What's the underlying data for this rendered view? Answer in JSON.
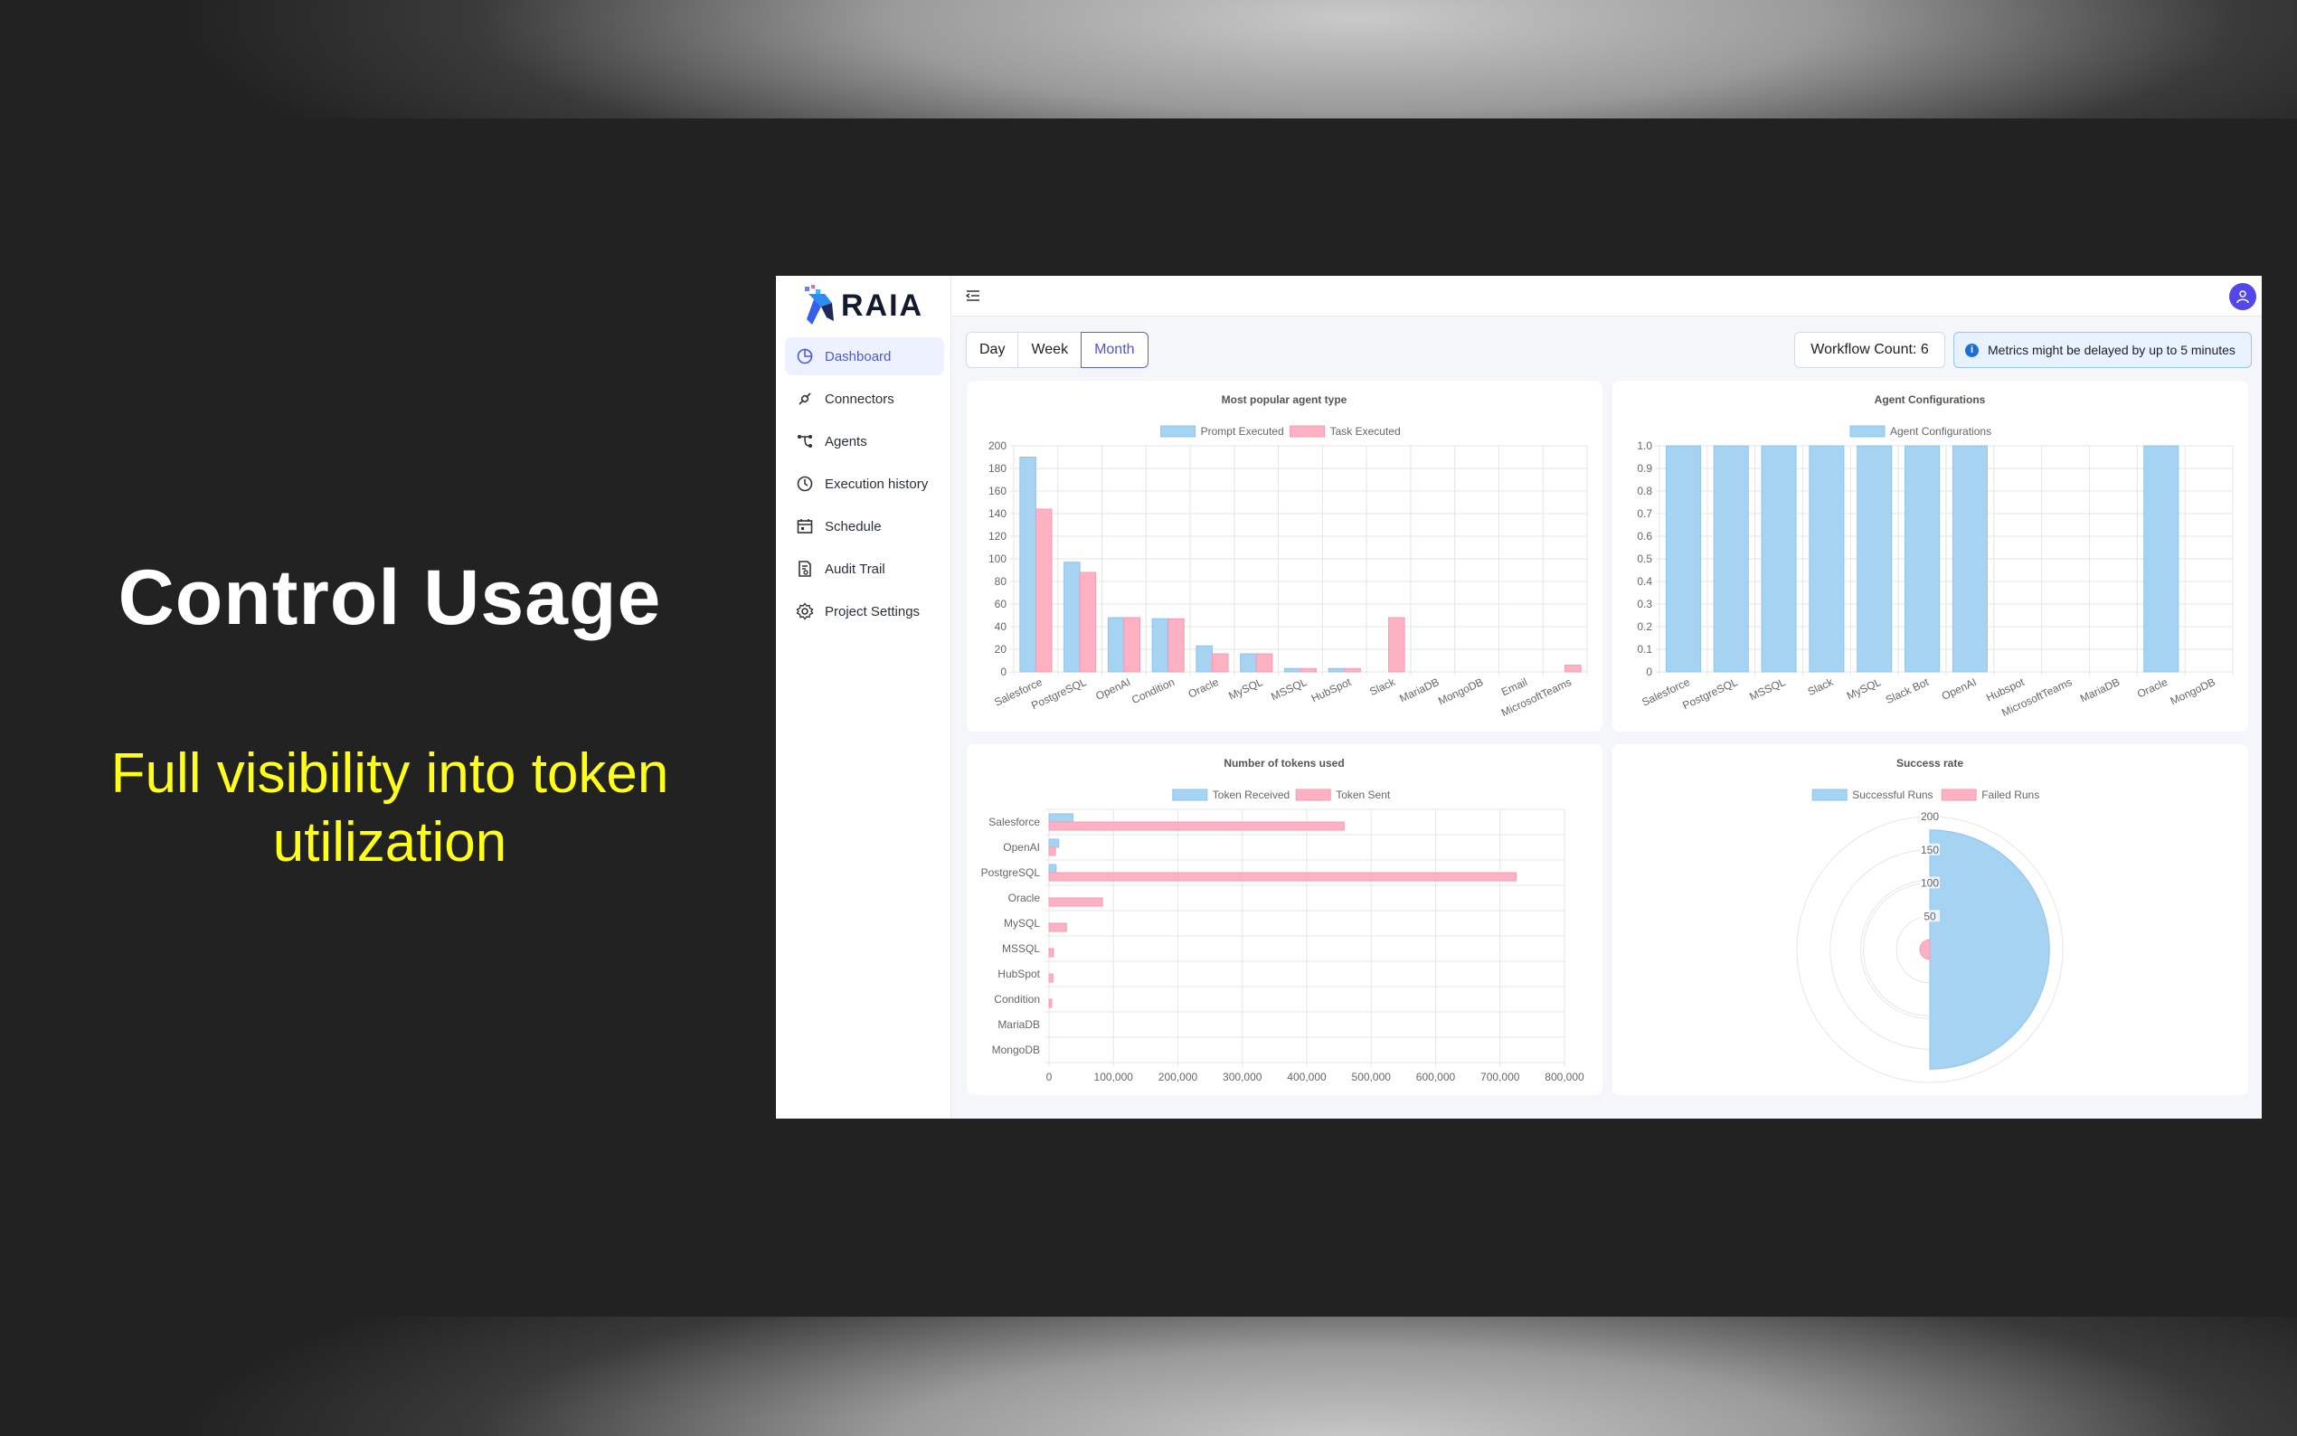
{
  "hero": {
    "title": "Control Usage",
    "subtitle": "Full visibility into token utilization"
  },
  "app": {
    "brand": "RAIA",
    "sidebar": {
      "items": [
        {
          "label": "Dashboard",
          "icon": "dashboard-icon",
          "active": true
        },
        {
          "label": "Connectors",
          "icon": "connectors-icon"
        },
        {
          "label": "Agents",
          "icon": "agents-icon"
        },
        {
          "label": "Execution history",
          "icon": "history-icon"
        },
        {
          "label": "Schedule",
          "icon": "schedule-icon"
        },
        {
          "label": "Audit Trail",
          "icon": "audit-icon"
        },
        {
          "label": "Project Settings",
          "icon": "settings-icon"
        }
      ]
    },
    "periods": [
      "Day",
      "Week",
      "Month"
    ],
    "active_period": "Month",
    "workflow_count_label": "Workflow Count:",
    "workflow_count": "6",
    "notice": "Metrics might be delayed by up to 5 minutes",
    "colors": {
      "blue": "#a7d3f3",
      "pink": "#fdb1c3",
      "accent": "#4c54d8"
    }
  },
  "chart_data": [
    {
      "type": "bar",
      "title": "Most popular agent type",
      "categories": [
        "Salesforce",
        "PostgreSQL",
        "OpenAI",
        "Condition",
        "Oracle",
        "MySQL",
        "MSSQL",
        "HubSpot",
        "Slack",
        "MariaDB",
        "MongoDB",
        "Email",
        "MicrosoftTeams"
      ],
      "series": [
        {
          "name": "Prompt Executed",
          "values": [
            190,
            97,
            48,
            47,
            23,
            16,
            3,
            3,
            0,
            0,
            0,
            0,
            0
          ]
        },
        {
          "name": "Task Executed",
          "values": [
            144,
            88,
            48,
            47,
            16,
            16,
            3,
            3,
            48,
            0,
            0,
            0,
            6
          ]
        }
      ],
      "ylim": [
        0,
        200
      ],
      "yticks": [
        0,
        20,
        40,
        60,
        80,
        100,
        120,
        140,
        160,
        180,
        200
      ],
      "legend": "top"
    },
    {
      "type": "bar",
      "title": "Agent Configurations",
      "categories": [
        "Salesforce",
        "PostgreSQL",
        "MSSQL",
        "Slack",
        "MySQL",
        "Slack Bot",
        "OpenAI",
        "Hubspot",
        "MicrosoftTeams",
        "MariaDB",
        "Oracle",
        "MongoDB"
      ],
      "series": [
        {
          "name": "Agent Configurations",
          "values": [
            1,
            1,
            1,
            1,
            1,
            1,
            1,
            0,
            0,
            0,
            1,
            0
          ]
        }
      ],
      "ylim": [
        0,
        1
      ],
      "yticks": [
        "0",
        "0.1",
        "0.2",
        "0.3",
        "0.4",
        "0.5",
        "0.6",
        "0.7",
        "0.8",
        "0.9",
        "1.0"
      ],
      "legend": "top"
    },
    {
      "type": "bar",
      "orientation": "horizontal",
      "title": "Number of tokens used",
      "categories": [
        "Salesforce",
        "OpenAI",
        "PostgreSQL",
        "Oracle",
        "MySQL",
        "MSSQL",
        "HubSpot",
        "Condition",
        "MariaDB",
        "MongoDB"
      ],
      "series": [
        {
          "name": "Token Received",
          "values": [
            37000,
            15000,
            11000,
            0,
            0,
            0,
            0,
            0,
            0,
            0
          ]
        },
        {
          "name": "Token Sent",
          "values": [
            458000,
            10000,
            725000,
            83000,
            27000,
            7000,
            6000,
            4000,
            0,
            0
          ]
        }
      ],
      "xlim": [
        0,
        800000
      ],
      "xticks": [
        "0",
        "100,000",
        "200,000",
        "300,000",
        "400,000",
        "500,000",
        "600,000",
        "700,000",
        "800,000"
      ],
      "legend": "top"
    },
    {
      "type": "polarArea",
      "title": "Success rate",
      "series": [
        {
          "name": "Successful Runs",
          "value": 180
        },
        {
          "name": "Failed Runs",
          "value": 15
        }
      ],
      "rlim": [
        0,
        200
      ],
      "rticks": [
        "50",
        "100",
        "150",
        "200"
      ],
      "legend": "top"
    }
  ]
}
